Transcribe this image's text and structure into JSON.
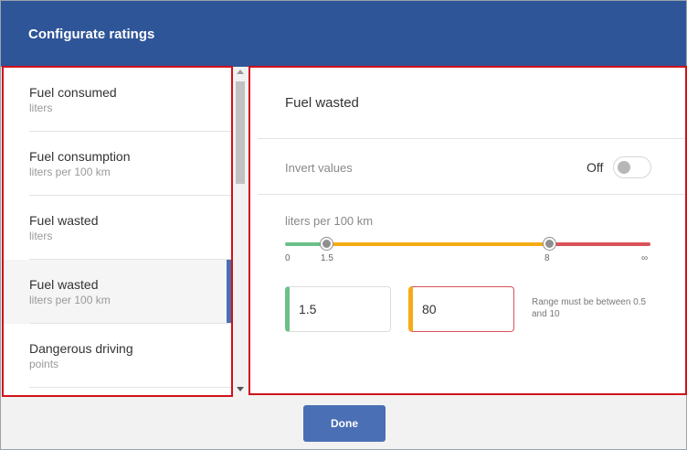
{
  "header": {
    "title": "Configurate ratings"
  },
  "list": {
    "items": [
      {
        "name": "Fuel consumed",
        "unit": "liters"
      },
      {
        "name": "Fuel consumption",
        "unit": "liters per 100 km"
      },
      {
        "name": "Fuel wasted",
        "unit": "liters"
      },
      {
        "name": "Fuel wasted",
        "unit": "liters per 100 km",
        "selected": true
      },
      {
        "name": "Dangerous driving",
        "unit": "points"
      }
    ]
  },
  "detail": {
    "title": "Fuel wasted",
    "invert_label": "Invert values",
    "invert_state": "Off",
    "unit_label": "liters per 100 km",
    "slider": {
      "ticks": [
        "0",
        "1.5",
        "8",
        "∞"
      ],
      "thresholds": [
        1.5,
        8
      ],
      "colors": {
        "good": "#6cc08a",
        "medium": "#f5ac14",
        "bad": "#d9525a"
      }
    },
    "inputs": {
      "low_value": "1.5",
      "high_value": "80"
    },
    "error_message": "Range must be between 0.5 and 10"
  },
  "footer": {
    "done_label": "Done"
  },
  "colors": {
    "header_bg": "#2e5597",
    "accent": "#4a6fb5",
    "error_outline": "#d0121b"
  }
}
